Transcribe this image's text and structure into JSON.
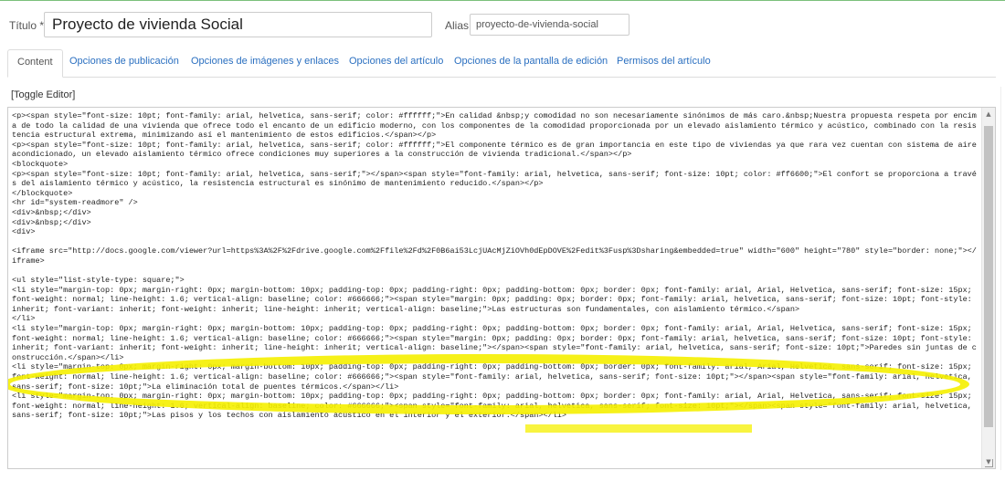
{
  "form": {
    "title_label": "Título *",
    "title_value": "Proyecto de vivienda Social",
    "alias_label": "Alias",
    "alias_value": "proyecto-de-vivienda-social"
  },
  "tabs": [
    {
      "label": "Content",
      "active": true
    },
    {
      "label": "Opciones de publicación",
      "active": false
    },
    {
      "label": "Opciones de imágenes y enlaces",
      "active": false
    },
    {
      "label": "Opciones del artículo",
      "active": false
    },
    {
      "label": "Opciones de la pantalla de edición",
      "active": false
    },
    {
      "label": "Permisos del artículo",
      "active": false
    }
  ],
  "toggle_editor": "[Toggle Editor]",
  "editor": {
    "code": "<p><span style=\"font-size: 10pt; font-family: arial, helvetica, sans-serif; color: #ffffff;\">En calidad &nbsp;y comodidad no son necesariamente sinónimos de más caro.&nbsp;Nuestra propuesta respeta por encima de todo la calidad de una vivienda que ofrece todo el encanto de un edificio moderno, con los componentes de la comodidad proporcionada por un elevado aislamiento térmico y acústico, combinado con la resistencia estructural extrema, minimizando así el mantenimiento de estos edificios.</span></p>\n<p><span style=\"font-size: 10pt; font-family: arial, helvetica, sans-serif; color: #ffffff;\">El componente térmico es de gran importancia en este tipo de viviendas ya que rara vez cuentan con sistema de aire acondicionado, un elevado aislamiento térmico ofrece condiciones muy superiores a la construcción de vivienda tradicional.</span></p>\n<blockquote>\n<p><span style=\"font-size: 10pt; font-family: arial, helvetica, sans-serif;\"></span><span style=\"font-family: arial, helvetica, sans-serif; font-size: 10pt; color: #ff6600;\">El confort se proporciona a través del aislamiento térmico y acústico, la resistencia estructural es sinónimo de mantenimiento reducido.</span></p>\n</blockquote>\n<hr id=\"system-readmore\" />\n<div>&nbsp;</div>\n<div>&nbsp;</div>\n<div>\n\n<iframe src=\"http://docs.google.com/viewer?url=https%3A%2F%2Fdrive.google.com%2Ffile%2Fd%2F0B6ai53LcjUAcMjZiOVh0dEpDOVE%2Fedit%3Fusp%3Dsharing&embedded=true\" width=\"600\" height=\"780\" style=\"border: none;\"></iframe>\n\n<ul style=\"list-style-type: square;\">\n<li style=\"margin-top: 0px; margin-right: 0px; margin-bottom: 10px; padding-top: 0px; padding-right: 0px; padding-bottom: 0px; border: 0px; font-family: arial, Arial, Helvetica, sans-serif; font-size: 15px; font-weight: normal; line-height: 1.6; vertical-align: baseline; color: #666666;\"><span style=\"margin: 0px; padding: 0px; border: 0px; font-family: arial, helvetica, sans-serif; font-size: 10pt; font-style: inherit; font-variant: inherit; font-weight: inherit; line-height: inherit; vertical-align: baseline;\">Las estructuras son fundamentales, con aislamiento térmico.</span>\n</li>\n<li style=\"margin-top: 0px; margin-right: 0px; margin-bottom: 10px; padding-top: 0px; padding-right: 0px; padding-bottom: 0px; border: 0px; font-family: arial, Arial, Helvetica, sans-serif; font-size: 15px; font-weight: normal; line-height: 1.6; vertical-align: baseline; color: #666666;\"><span style=\"margin: 0px; padding: 0px; border: 0px; font-family: arial, helvetica, sans-serif; font-size: 10pt; font-style: inherit; font-variant: inherit; font-weight: inherit; line-height: inherit; vertical-align: baseline;\"></span><span style=\"font-family: arial, helvetica, sans-serif; font-size: 10pt;\">Paredes sin juntas de construcción.</span></li>\n<li style=\"margin-top: 0px; margin-right: 0px; margin-bottom: 10px; padding-top: 0px; padding-right: 0px; padding-bottom: 0px; border: 0px; font-family: arial, Arial, Helvetica, sans-serif; font-size: 15px; font-weight: normal; line-height: 1.6; vertical-align: baseline; color: #666666;\"><span style=\"font-family: arial, helvetica, sans-serif; font-size: 10pt;\"></span><span style=\"font-family: arial, helvetica, sans-serif; font-size: 10pt;\">La eliminación total de puentes térmicos.</span></li>\n<li style=\"margin-top: 0px; margin-right: 0px; margin-bottom: 10px; padding-top: 0px; padding-right: 0px; padding-bottom: 0px; border: 0px; font-family: arial, Arial, Helvetica, sans-serif; font-size: 15px; font-weight: normal; line-height: 1.6; vertical-align: baseline; color: #666666;\"><span style=\"font-family: arial, helvetica, sans-serif; font-size: 10pt;\"></span><span style=\"font-family: arial, helvetica, sans-serif; font-size: 10pt;\">Las pisos y los techos con aislamiento acústico en el interior y el exterior.</span></li>"
  },
  "colors": {
    "tab_link": "#2a6fc0",
    "highlight": "#f5f000",
    "top_border": "#7cc07c"
  },
  "icons": [
    "scroll-up-arrow-icon",
    "scroll-down-arrow-icon",
    "resize-handle-icon"
  ]
}
